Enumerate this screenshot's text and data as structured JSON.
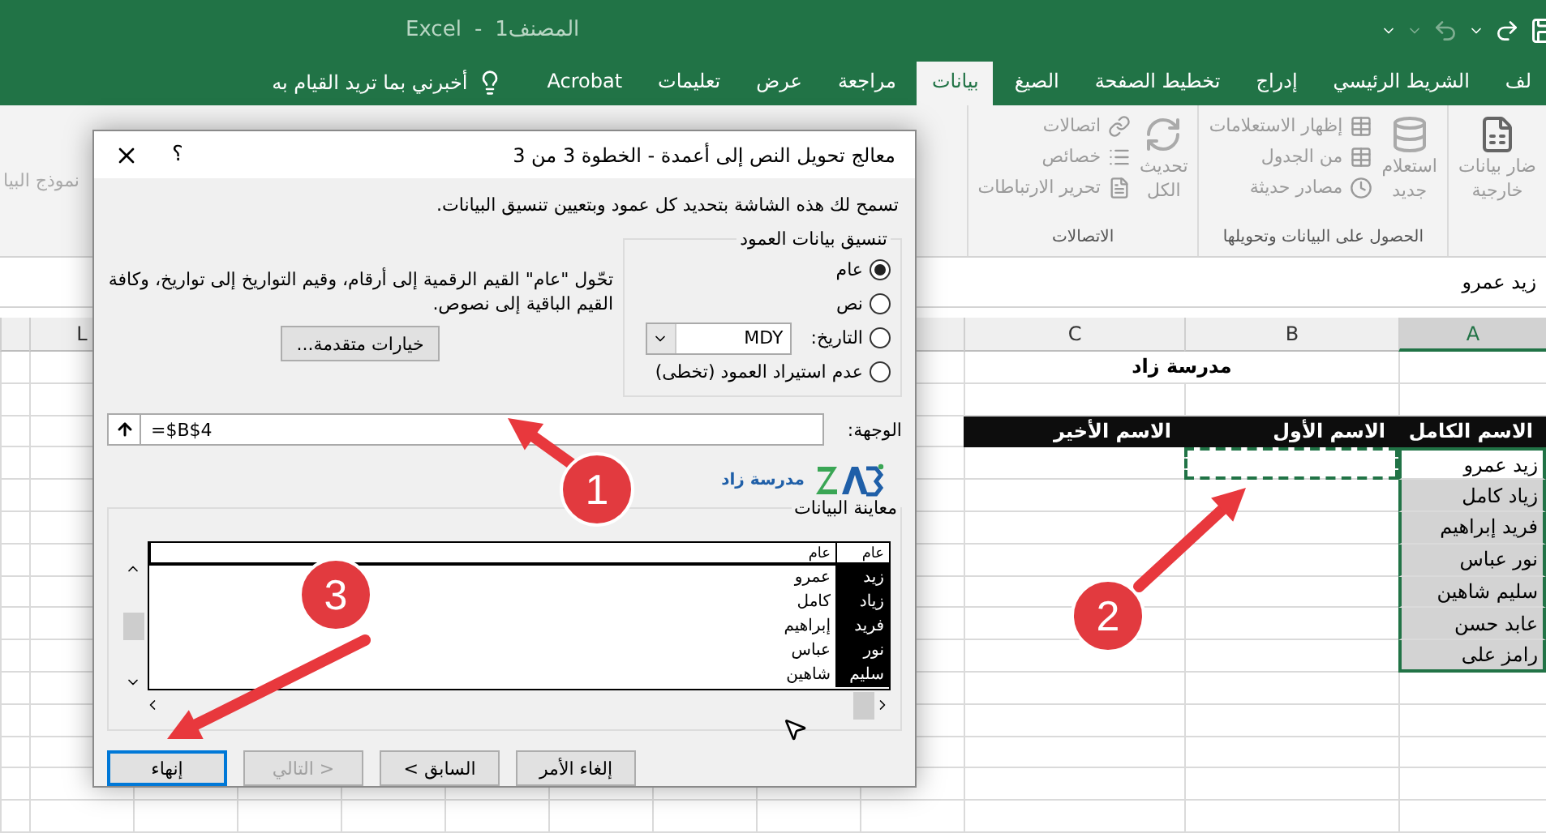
{
  "title_bar": {
    "app": "Excel",
    "separator": "-",
    "document": "المصنف1"
  },
  "ribbon_tabs": [
    {
      "label": "لف",
      "selected": false
    },
    {
      "label": "الشريط الرئيسي",
      "selected": false
    },
    {
      "label": "إدراج",
      "selected": false
    },
    {
      "label": "تخطيط الصفحة",
      "selected": false
    },
    {
      "label": "الصيغ",
      "selected": false
    },
    {
      "label": "بيانات",
      "selected": true
    },
    {
      "label": "مراجعة",
      "selected": false
    },
    {
      "label": "عرض",
      "selected": false
    },
    {
      "label": "تعليمات",
      "selected": false
    },
    {
      "label": "Acrobat",
      "selected": false
    }
  ],
  "tell_me": "أخبرني بما تريد القيام به",
  "ribbon": {
    "external_data": [
      "ضار بيانات",
      "خارجية"
    ],
    "get_transform": {
      "title": "الحصول على البيانات وتحويلها",
      "big": [
        "استعلام",
        "جديد"
      ],
      "items": [
        "إظهار الاستعلامات",
        "من الجدول",
        "مصادر حديثة"
      ]
    },
    "connections": {
      "title": "الاتصالات",
      "big": [
        "تحديث",
        "الكل"
      ],
      "items": [
        "اتصالات",
        "خصائص",
        "تحرير الارتباطات"
      ]
    },
    "left_label": "نموذج البيا"
  },
  "formula_bar": {
    "value": "زيد عمرو"
  },
  "sheet": {
    "columns": [
      {
        "label": "A",
        "selected": true
      },
      {
        "label": "B",
        "selected": false
      },
      {
        "label": "C",
        "selected": false
      },
      {
        "label": "L",
        "selected": false
      }
    ],
    "title_cell": "مدرسة زاد",
    "headers": [
      "الاسم الكامل",
      "الاسم الأول",
      "الاسم الأخير"
    ],
    "names": [
      {
        "text": "زيد عمرو",
        "highlighted": false
      },
      {
        "text": "زياد كامل",
        "highlighted": true
      },
      {
        "text": "فريد إبراهيم",
        "highlighted": true
      },
      {
        "text": "نور عباس",
        "highlighted": true
      },
      {
        "text": "سليم شاهين",
        "highlighted": true
      },
      {
        "text": "عابد حسن",
        "highlighted": true
      },
      {
        "text": "رامز على",
        "highlighted": true
      }
    ],
    "destination_outline": true
  },
  "dialog": {
    "title": "معالج تحويل النص إلى أعمدة - الخطوة 3 من 3",
    "help": "؟",
    "description": "تسمح لك هذه الشاشة بتحديد كل عمود وبتعيين تنسيق البيانات.",
    "format_legend": "تنسيق بيانات العمود",
    "formats": [
      {
        "kind": "plain",
        "label": "عام",
        "selected": true
      },
      {
        "kind": "plain",
        "label": "نص",
        "selected": false
      },
      {
        "kind": "date",
        "label": "التاريخ:",
        "value": "MDY",
        "selected": false
      },
      {
        "kind": "plain",
        "label": "عدم استيراد العمود (تخطى)",
        "selected": false
      }
    ],
    "explanation": "تحّول \"عام\" القيم الرقمية إلى أرقام، وقيم التواريخ إلى تواريخ، وكافة القيم الباقية إلى نصوص.",
    "advanced_button": "خيارات متقدمة...",
    "destination_label": "الوجهة:",
    "destination_value": "=$B$4",
    "logo_text": "مدرسة زاد",
    "preview_legend": "معاينة البيانات",
    "preview": {
      "columns": [
        {
          "header": "عام",
          "selected": true
        },
        {
          "header": "عام",
          "selected": false
        }
      ],
      "rows": [
        [
          "زيد",
          "عمرو"
        ],
        [
          "زياد",
          "كامل"
        ],
        [
          "فريد",
          "إبراهيم"
        ],
        [
          "نور",
          "عباس"
        ],
        [
          "سليم",
          "شاهين"
        ]
      ]
    },
    "buttons": [
      {
        "label": "إلغاء الأمر",
        "disabled": false,
        "default": false
      },
      {
        "label": "< السابق",
        "disabled": false,
        "default": false
      },
      {
        "label": "التالي >",
        "disabled": true,
        "default": false
      },
      {
        "label": "إنهاء",
        "disabled": false,
        "default": true
      }
    ]
  },
  "annotations": [
    {
      "label": "1"
    },
    {
      "label": "2"
    },
    {
      "label": "3"
    }
  ]
}
